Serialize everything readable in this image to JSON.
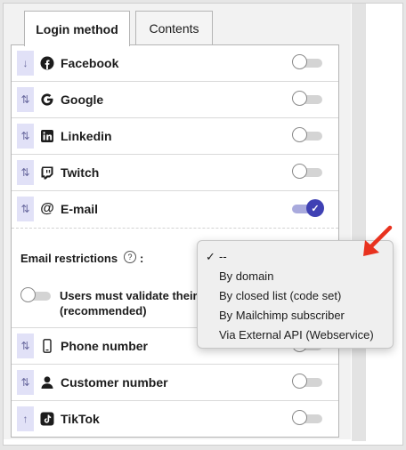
{
  "tabs": [
    {
      "label": "Login method",
      "active": true
    },
    {
      "label": "Contents",
      "active": false
    }
  ],
  "providers": [
    {
      "label": "Facebook",
      "icon": "facebook-icon",
      "handle": "↓",
      "enabled": false
    },
    {
      "label": "Google",
      "icon": "google-icon",
      "handle": "⇅",
      "enabled": false
    },
    {
      "label": "Linkedin",
      "icon": "linkedin-icon",
      "handle": "⇅",
      "enabled": false
    },
    {
      "label": "Twitch",
      "icon": "twitch-icon",
      "handle": "⇅",
      "enabled": false
    },
    {
      "label": "E-mail",
      "icon": "at-icon",
      "handle": "⇅",
      "enabled": true
    },
    {
      "label": "Phone number",
      "icon": "phone-icon",
      "handle": "⇅",
      "enabled": false
    },
    {
      "label": "Customer number",
      "icon": "person-icon",
      "handle": "⇅",
      "enabled": false
    },
    {
      "label": "TikTok",
      "icon": "tiktok-icon",
      "handle": "↑",
      "enabled": false
    }
  ],
  "email_settings": {
    "restrictions_label": "Email restrictions",
    "help_glyph": "?",
    "colon": ":",
    "validate_label": "Users must validate their (recommended)",
    "validate_enabled": false
  },
  "dropdown": {
    "selected_index": 0,
    "check_glyph": "✓",
    "options": [
      "--",
      "By domain",
      "By closed list (code set)",
      "By Mailchimp subscriber",
      "Via External API (Webservice)"
    ]
  },
  "colors": {
    "accent": "#3f41b4",
    "handle_bg": "#e1e1f7",
    "arrow": "#e8321f"
  }
}
